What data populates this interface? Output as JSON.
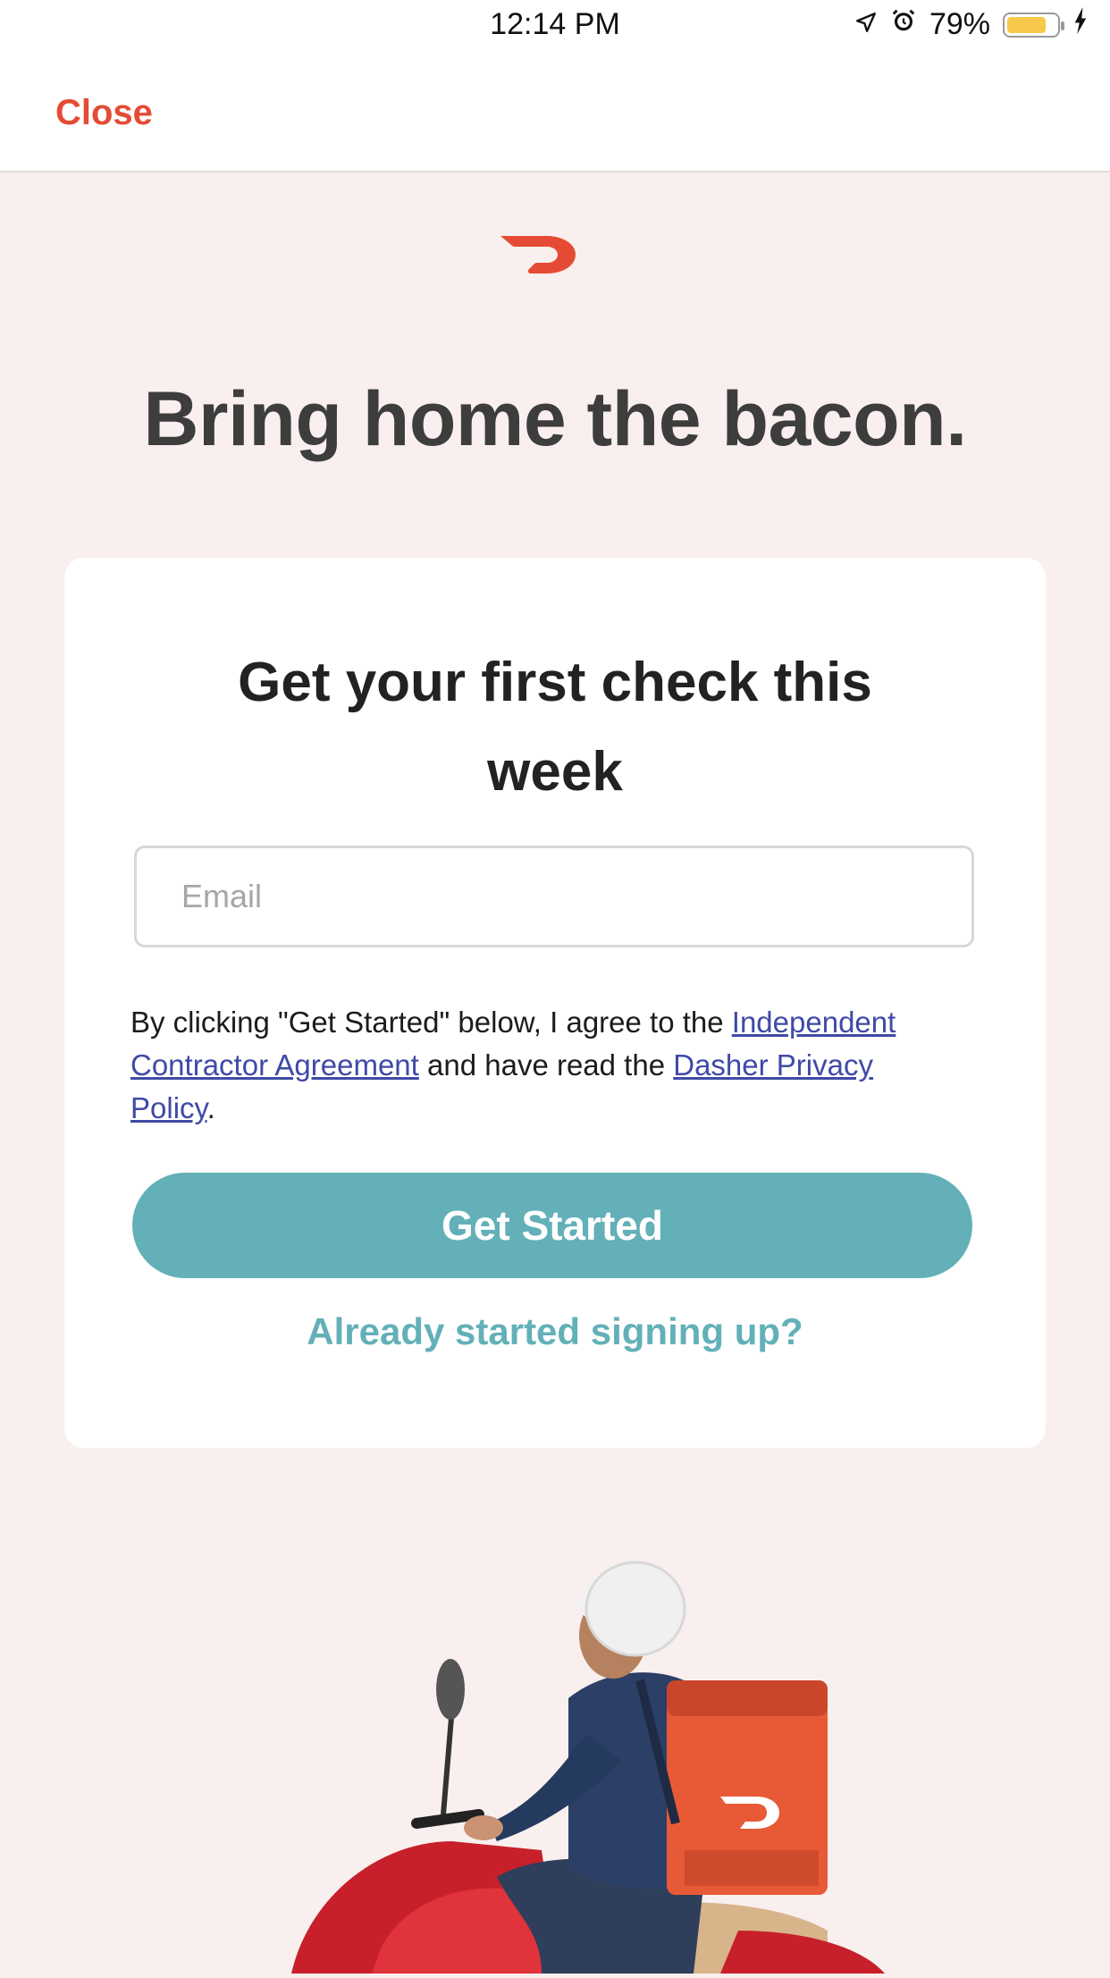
{
  "status_bar": {
    "time": "12:14 PM",
    "battery": "79%",
    "battery_level": 0.79,
    "icons": [
      "location-arrow-icon",
      "alarm-icon",
      "battery-icon",
      "charging-bolt-icon"
    ]
  },
  "header": {
    "close_label": "Close"
  },
  "brand": {
    "logo_icon": "doordash-logo-icon",
    "accent_color": "#e54b34"
  },
  "headline": "Bring home the bacon.",
  "card": {
    "title": "Get your first check this week",
    "email_placeholder": "Email",
    "terms": {
      "prefix": "By clicking \"Get Started\" below, I agree to the ",
      "agreement_link": "Independent Contractor Agreement",
      "middle": " and have read the ",
      "privacy_link": "Dasher Privacy Policy",
      "suffix": "."
    },
    "button_label": "Get Started",
    "already_started": "Already started signing up?"
  },
  "colors": {
    "background": "#f9efee",
    "button": "#63b0b8",
    "link": "#3f4aa6"
  }
}
